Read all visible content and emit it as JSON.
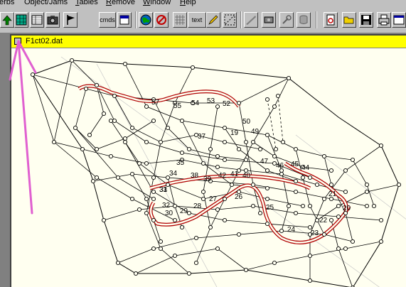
{
  "menu": {
    "items": [
      {
        "pre": "",
        "acc": "",
        "post": "erbs"
      },
      {
        "pre": "Object/",
        "acc": "",
        "post": "Jams"
      },
      {
        "pre": "",
        "acc": "T",
        "post": "ables"
      },
      {
        "pre": "",
        "acc": "R",
        "post": "emove"
      },
      {
        "pre": "",
        "acc": "W",
        "post": "indow"
      },
      {
        "pre": "",
        "acc": "H",
        "post": "elp"
      }
    ]
  },
  "toolbar": {
    "cmds_label": "cmds",
    "text_label": "text",
    "icons": [
      "up-arrow-icon",
      "grid-green-icon",
      "table-icon",
      "camera-icon",
      "flag-icon",
      "cmds-icon",
      "notebook-icon",
      "globe-icon",
      "signal-icon",
      "grid-icon",
      "text-icon",
      "pencil-icon",
      "select-dashed-icon",
      "road-icon",
      "tools-icon",
      "wrench-icon",
      "cylinder-icon",
      "pdf-icon",
      "open-folder-icon",
      "save-icon",
      "print-icon",
      "window-icon"
    ]
  },
  "document": {
    "title": "F1ct02.dat"
  },
  "labels": [
    "57",
    "55",
    "54",
    "53",
    "52",
    "50",
    "49",
    "47",
    "46",
    "45",
    "44",
    "42",
    "41",
    "40",
    "39",
    "38",
    "37",
    "35",
    "34",
    "33",
    "32",
    "31",
    "30",
    "29",
    "28",
    "27",
    "26",
    "25",
    "24",
    "23",
    "22",
    "21",
    "20",
    "19"
  ]
}
